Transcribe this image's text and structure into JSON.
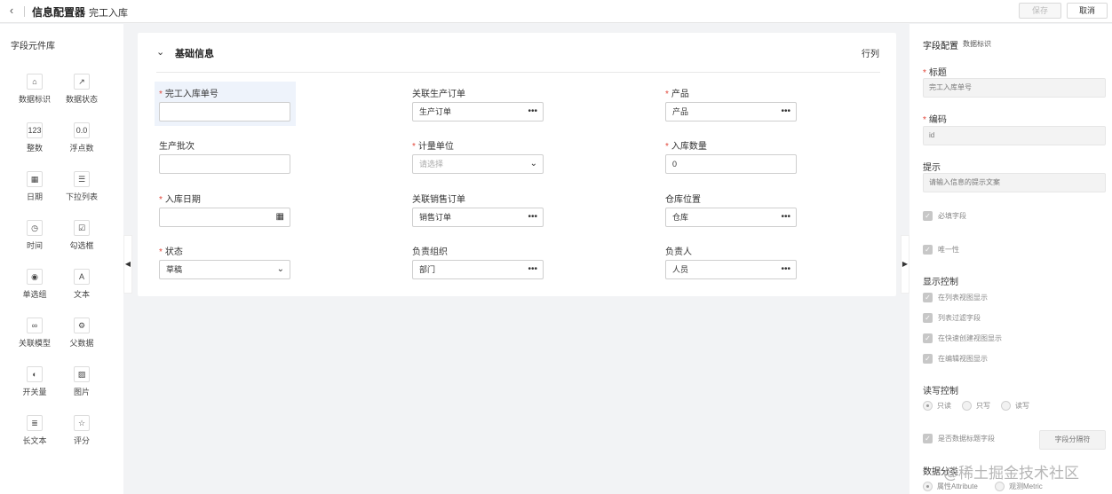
{
  "header": {
    "back_icon": "chevron-left-icon",
    "title": "信息配置器",
    "subtitle": "完工入库",
    "save_label": "保存",
    "cancel_label": "取消"
  },
  "left_panel": {
    "title": "字段元件库",
    "components": [
      {
        "label": "数据标识",
        "icon": "tag-icon",
        "glyph": "⌂"
      },
      {
        "label": "数据状态",
        "icon": "trend-icon",
        "glyph": "↗"
      },
      {
        "label": "整数",
        "icon": "integer-icon",
        "glyph": "123"
      },
      {
        "label": "浮点数",
        "icon": "float-icon",
        "glyph": "0.0"
      },
      {
        "label": "日期",
        "icon": "calendar-icon",
        "glyph": "▦"
      },
      {
        "label": "下拉列表",
        "icon": "dropdown-list-icon",
        "glyph": "☰"
      },
      {
        "label": "时间",
        "icon": "clock-icon",
        "glyph": "◷"
      },
      {
        "label": "勾选框",
        "icon": "checkbox-icon",
        "glyph": "☑"
      },
      {
        "label": "单选组",
        "icon": "radio-icon",
        "glyph": "◉"
      },
      {
        "label": "文本",
        "icon": "text-icon",
        "glyph": "A"
      },
      {
        "label": "关联模型",
        "icon": "link-icon",
        "glyph": "∞"
      },
      {
        "label": "父数据",
        "icon": "gear-icon",
        "glyph": "⚙"
      },
      {
        "label": "开关量",
        "icon": "toggle-icon",
        "glyph": "◐"
      },
      {
        "label": "图片",
        "icon": "image-icon",
        "glyph": "▨"
      },
      {
        "label": "长文本",
        "icon": "long-text-icon",
        "glyph": "≣"
      },
      {
        "label": "评分",
        "icon": "star-icon",
        "glyph": "☆"
      }
    ]
  },
  "form": {
    "section_title": "基础信息",
    "section_icon": "chevron-down-icon",
    "rowcol_label": "行列",
    "fields": [
      {
        "label": "完工入库单号",
        "required": true,
        "value": "",
        "type": "text"
      },
      {
        "label": "关联生产订单",
        "required": false,
        "value": "生产订单",
        "type": "lookup"
      },
      {
        "label": "产品",
        "required": true,
        "value": "产品",
        "type": "lookup"
      },
      {
        "label": "生产批次",
        "required": false,
        "value": "",
        "type": "text"
      },
      {
        "label": "计量单位",
        "required": true,
        "placeholder": "请选择",
        "type": "select"
      },
      {
        "label": "入库数量",
        "required": true,
        "value": "0",
        "type": "text"
      },
      {
        "label": "入库日期",
        "required": true,
        "value": "",
        "type": "date"
      },
      {
        "label": "关联销售订单",
        "required": false,
        "value": "销售订单",
        "type": "lookup"
      },
      {
        "label": "仓库位置",
        "required": false,
        "value": "仓库",
        "type": "lookup"
      },
      {
        "label": "状态",
        "required": true,
        "value": "草稿",
        "type": "select"
      },
      {
        "label": "负责组织",
        "required": false,
        "value": "部门",
        "type": "lookup"
      },
      {
        "label": "负责人",
        "required": false,
        "value": "人员",
        "type": "lookup"
      }
    ]
  },
  "right_panel": {
    "title": "字段配置",
    "subtitle": "数据标识",
    "title_label": "标题",
    "title_value": "完工入库单号",
    "code_label": "编码",
    "code_value": "id",
    "hint_label": "提示",
    "hint_placeholder": "请输入信息的提示文案",
    "required_field": "必填字段",
    "unique": "唯一性",
    "display_control": "显示控制",
    "display_options": [
      "在列表视图显示",
      "列表过滤字段",
      "在快速创建视图显示",
      "在编辑视图显示"
    ],
    "rw_control": "读写控制",
    "rw_options": [
      "只读",
      "只写",
      "读写"
    ],
    "title_field_check": "是否数据标题字段",
    "separator_placeholder": "字段分隔符",
    "data_category": "数据分类",
    "data_category_options": [
      "属性Attribute",
      "观测Metric"
    ]
  },
  "watermark": "@稀土掘金技术社区"
}
